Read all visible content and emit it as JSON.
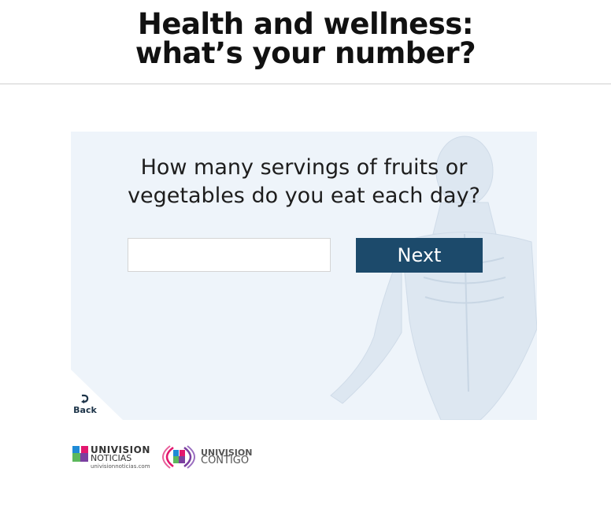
{
  "header": {
    "title_line1": "Health and wellness:",
    "title_line2": "what’s your number?"
  },
  "quiz": {
    "question_line1": "How many servings of fruits or",
    "question_line2": "vegetables do you eat each day?",
    "answer_value": "",
    "next_label": "Next",
    "back_label": "Back"
  },
  "footer": {
    "logo1_brand": "UNIVISION",
    "logo1_sub": "NOTICIAS",
    "logo1_url": "univisionnoticias.com",
    "logo2_brand": "UNIVISION",
    "logo2_sub": "CONTIGO"
  },
  "colors": {
    "accent": "#1c4a6b",
    "card_bg": "#eef4fa"
  },
  "icons": {
    "back": "curved-arrow-icon",
    "background": "human-anatomy-figure"
  }
}
